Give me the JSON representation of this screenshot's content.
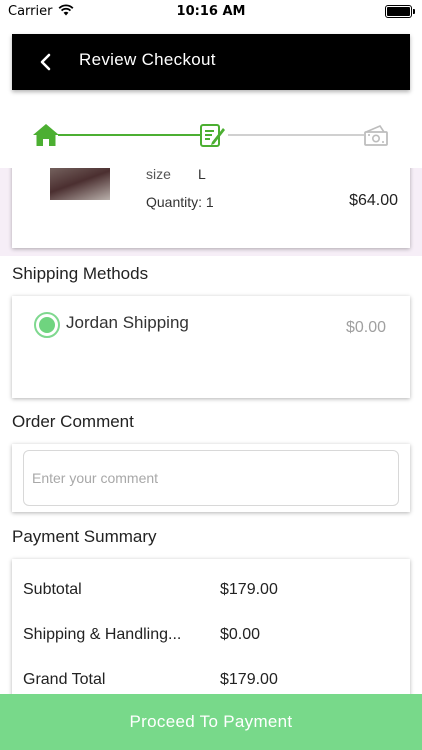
{
  "status_bar": {
    "carrier": "Carrier",
    "time": "10:16 AM",
    "wifi_icon": "wifi-icon",
    "battery_icon": "battery-icon"
  },
  "header": {
    "back_icon": "chevron-left-icon",
    "title": "Review Checkout",
    "background": "#000000"
  },
  "stepper": {
    "steps": [
      {
        "icon": "home-icon",
        "state": "done"
      },
      {
        "icon": "edit-list-icon",
        "state": "current"
      },
      {
        "icon": "money-icon",
        "state": "todo"
      }
    ],
    "active_color": "#4caf32",
    "inactive_color": "#d0d0d0"
  },
  "product": {
    "size_label": "size",
    "size_value": "L",
    "quantity": "Quantity: 1",
    "price": "$64.00"
  },
  "shipping": {
    "title": "Shipping Methods",
    "method_name": "Jordan Shipping",
    "method_price": "$0.00",
    "selected": true
  },
  "comment": {
    "title": "Order Comment",
    "placeholder": "Enter your comment",
    "value": ""
  },
  "summary": {
    "title": "Payment Summary",
    "rows": [
      {
        "label": "Subtotal",
        "value": "$179.00"
      },
      {
        "label": "Shipping & Handling...",
        "value": "$0.00"
      },
      {
        "label": "Grand Total",
        "value": "$179.00"
      }
    ]
  },
  "footer": {
    "proceed_label": "Proceed To Payment",
    "color": "#78d98a"
  }
}
